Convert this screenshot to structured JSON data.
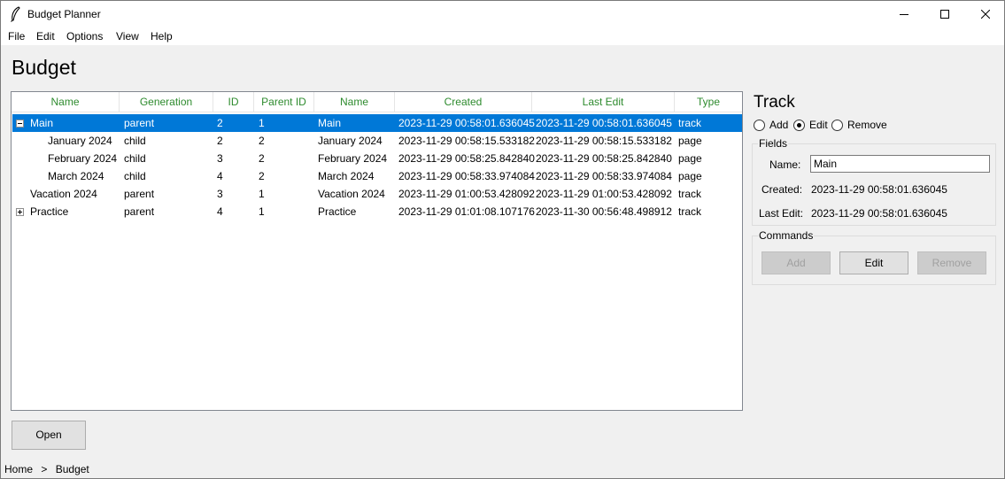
{
  "window": {
    "title": "Budget Planner"
  },
  "menu": [
    "File",
    "Edit",
    "Options",
    "View",
    "Help"
  ],
  "page": {
    "title": "Budget"
  },
  "table": {
    "columns": [
      "Name",
      "Generation",
      "ID",
      "Parent ID",
      "Name",
      "Created",
      "Last Edit",
      "Type"
    ],
    "rows": [
      {
        "tree": "Main",
        "generation": "parent",
        "id": "2",
        "parent_id": "1",
        "name": "Main",
        "created": "2023-11-29 00:58:01.636045",
        "last_edit": "2023-11-29 00:58:01.636045",
        "type": "track",
        "expander": "minus",
        "level": 0,
        "selected": true
      },
      {
        "tree": "January 2024",
        "generation": "child",
        "id": "2",
        "parent_id": "2",
        "name": "January 2024",
        "created": "2023-11-29 00:58:15.533182",
        "last_edit": "2023-11-29 00:58:15.533182",
        "type": "page",
        "expander": "",
        "level": 1,
        "selected": false
      },
      {
        "tree": "February 2024",
        "generation": "child",
        "id": "3",
        "parent_id": "2",
        "name": "February 2024",
        "created": "2023-11-29 00:58:25.842840",
        "last_edit": "2023-11-29 00:58:25.842840",
        "type": "page",
        "expander": "",
        "level": 1,
        "selected": false
      },
      {
        "tree": "March 2024",
        "generation": "child",
        "id": "4",
        "parent_id": "2",
        "name": "March 2024",
        "created": "2023-11-29 00:58:33.974084",
        "last_edit": "2023-11-29 00:58:33.974084",
        "type": "page",
        "expander": "",
        "level": 1,
        "selected": false
      },
      {
        "tree": "Vacation 2024",
        "generation": "parent",
        "id": "3",
        "parent_id": "1",
        "name": "Vacation 2024",
        "created": "2023-11-29 01:00:53.428092",
        "last_edit": "2023-11-29 01:00:53.428092",
        "type": "track",
        "expander": "",
        "level": 0,
        "selected": false
      },
      {
        "tree": "Practice",
        "generation": "parent",
        "id": "4",
        "parent_id": "1",
        "name": "Practice",
        "created": "2023-11-29 01:01:08.107176",
        "last_edit": "2023-11-30 00:56:48.498912",
        "type": "track",
        "expander": "plus",
        "level": 0,
        "selected": false
      }
    ]
  },
  "buttons": {
    "open": "Open"
  },
  "track": {
    "title": "Track",
    "mode": {
      "add": "Add",
      "edit": "Edit",
      "remove": "Remove",
      "selected": "edit"
    },
    "fields": {
      "legend": "Fields",
      "name_label": "Name:",
      "name_value": "Main",
      "created_label": "Created:",
      "created_value": "2023-11-29 00:58:01.636045",
      "last_edit_label": "Last Edit:",
      "last_edit_value": "2023-11-29 00:58:01.636045"
    },
    "commands": {
      "legend": "Commands",
      "add": "Add",
      "edit": "Edit",
      "remove": "Remove"
    }
  },
  "breadcrumb": {
    "home": "Home",
    "separator": ">",
    "current": "Budget"
  },
  "colors": {
    "header_text": "#2e8b2e",
    "selection": "#0078d7"
  }
}
